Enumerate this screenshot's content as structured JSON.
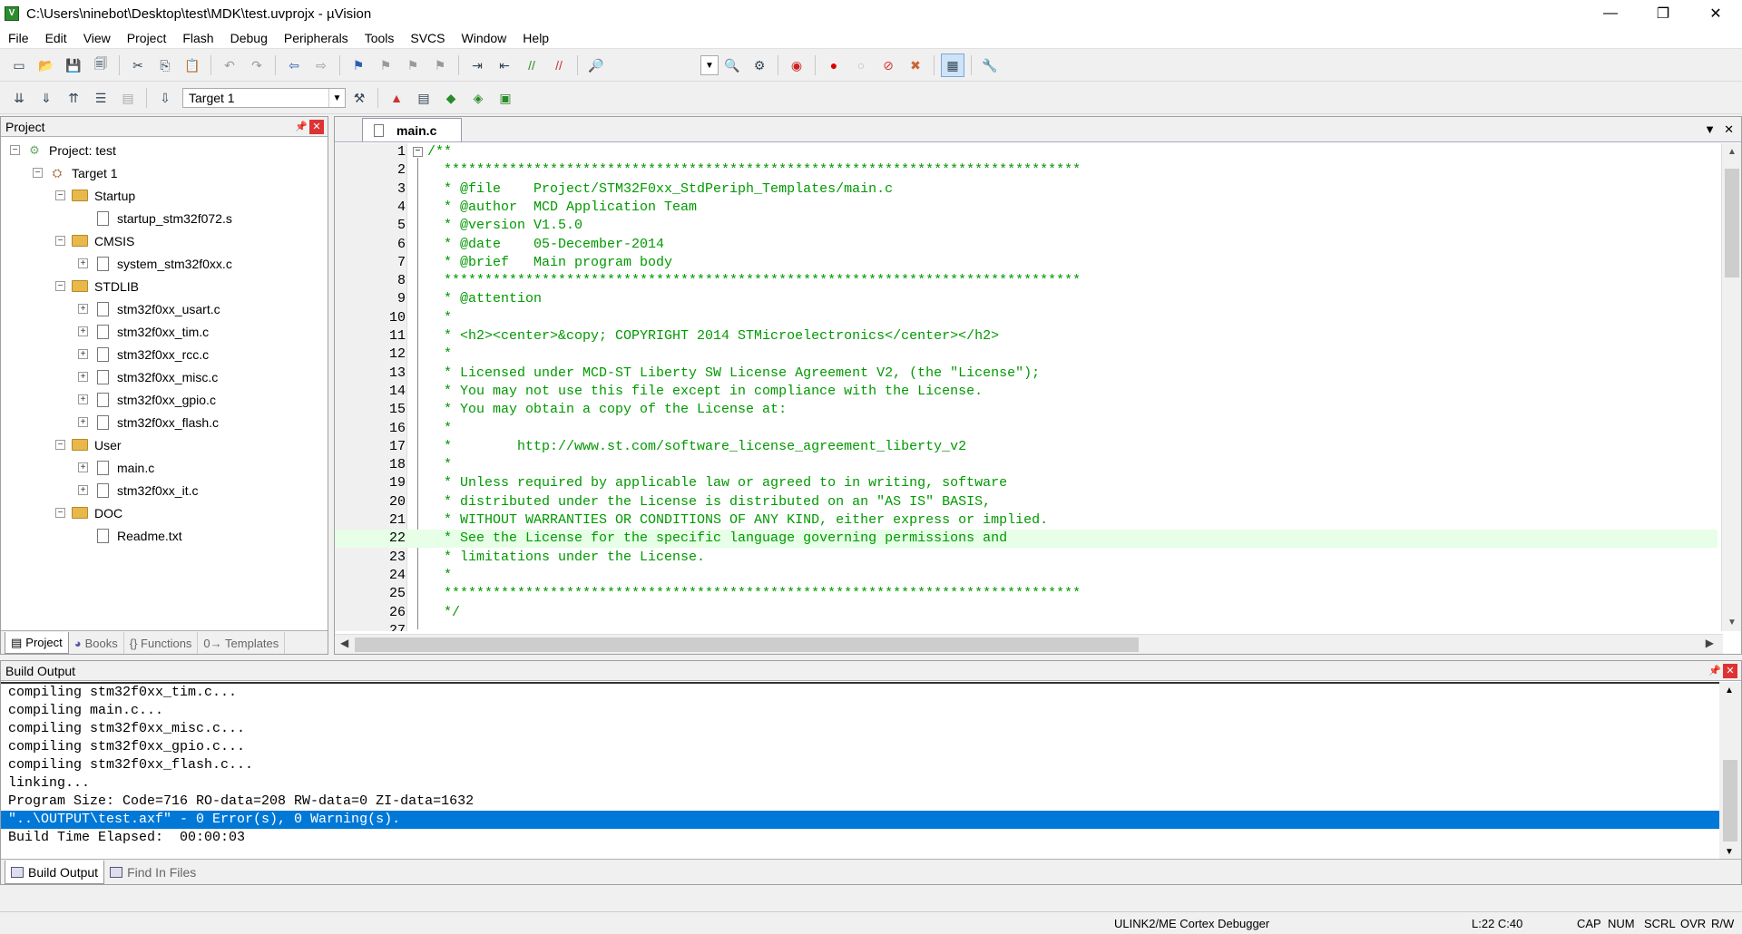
{
  "window": {
    "title": "C:\\Users\\ninebot\\Desktop\\test\\MDK\\test.uvprojx - µVision",
    "minimize": "—",
    "restore": "❐",
    "close": "✕"
  },
  "menu": [
    "File",
    "Edit",
    "View",
    "Project",
    "Flash",
    "Debug",
    "Peripherals",
    "Tools",
    "SVCS",
    "Window",
    "Help"
  ],
  "toolbar2": {
    "target": "Target 1"
  },
  "project_panel": {
    "title": "Project",
    "tree": [
      {
        "label": "Project: test",
        "level": 0,
        "exp": "−",
        "icon": "project"
      },
      {
        "label": "Target 1",
        "level": 1,
        "exp": "−",
        "icon": "target"
      },
      {
        "label": "Startup",
        "level": 2,
        "exp": "−",
        "icon": "folder"
      },
      {
        "label": "startup_stm32f072.s",
        "level": 3,
        "exp": "",
        "icon": "file"
      },
      {
        "label": "CMSIS",
        "level": 2,
        "exp": "−",
        "icon": "folder"
      },
      {
        "label": "system_stm32f0xx.c",
        "level": 3,
        "exp": "+",
        "icon": "file"
      },
      {
        "label": "STDLIB",
        "level": 2,
        "exp": "−",
        "icon": "folder"
      },
      {
        "label": "stm32f0xx_usart.c",
        "level": 3,
        "exp": "+",
        "icon": "file"
      },
      {
        "label": "stm32f0xx_tim.c",
        "level": 3,
        "exp": "+",
        "icon": "file"
      },
      {
        "label": "stm32f0xx_rcc.c",
        "level": 3,
        "exp": "+",
        "icon": "file"
      },
      {
        "label": "stm32f0xx_misc.c",
        "level": 3,
        "exp": "+",
        "icon": "file"
      },
      {
        "label": "stm32f0xx_gpio.c",
        "level": 3,
        "exp": "+",
        "icon": "file"
      },
      {
        "label": "stm32f0xx_flash.c",
        "level": 3,
        "exp": "+",
        "icon": "file"
      },
      {
        "label": "User",
        "level": 2,
        "exp": "−",
        "icon": "folder"
      },
      {
        "label": "main.c",
        "level": 3,
        "exp": "+",
        "icon": "file"
      },
      {
        "label": "stm32f0xx_it.c",
        "level": 3,
        "exp": "+",
        "icon": "file"
      },
      {
        "label": "DOC",
        "level": 2,
        "exp": "−",
        "icon": "folder"
      },
      {
        "label": "Readme.txt",
        "level": 3,
        "exp": "",
        "icon": "file"
      }
    ],
    "tabs": [
      "Project",
      "Books",
      "{} Functions",
      "0→ Templates"
    ]
  },
  "editor": {
    "tab": "main.c",
    "cursor_line": 22,
    "lines": [
      "/**",
      "  ******************************************************************************",
      "  * @file    Project/STM32F0xx_StdPeriph_Templates/main.c",
      "  * @author  MCD Application Team",
      "  * @version V1.5.0",
      "  * @date    05-December-2014",
      "  * @brief   Main program body",
      "  ******************************************************************************",
      "  * @attention",
      "  *",
      "  * <h2><center>&copy; COPYRIGHT 2014 STMicroelectronics</center></h2>",
      "  *",
      "  * Licensed under MCD-ST Liberty SW License Agreement V2, (the \"License\");",
      "  * You may not use this file except in compliance with the License.",
      "  * You may obtain a copy of the License at:",
      "  *",
      "  *        http://www.st.com/software_license_agreement_liberty_v2",
      "  *",
      "  * Unless required by applicable law or agreed to in writing, software",
      "  * distributed under the License is distributed on an \"AS IS\" BASIS,",
      "  * WITHOUT WARRANTIES OR CONDITIONS OF ANY KIND, either express or implied.",
      "  * See the License for the specific language governing permissions and",
      "  * limitations under the License.",
      "  *",
      "  ******************************************************************************",
      "  */",
      ""
    ]
  },
  "build_output": {
    "title": "Build Output",
    "lines": [
      "compiling stm32f0xx_tim.c...",
      "compiling main.c...",
      "compiling stm32f0xx_misc.c...",
      "compiling stm32f0xx_gpio.c...",
      "compiling stm32f0xx_flash.c...",
      "linking...",
      "Program Size: Code=716 RO-data=208 RW-data=0 ZI-data=1632",
      "\"..\\OUTPUT\\test.axf\" - 0 Error(s), 0 Warning(s).",
      "Build Time Elapsed:  00:00:03"
    ],
    "selected_index": 7,
    "tabs": [
      "Build Output",
      "Find In Files"
    ]
  },
  "status": {
    "debugger": "ULINK2/ME Cortex Debugger",
    "position": "L:22 C:40",
    "cap": "CAP",
    "num": "NUM",
    "scrl": "SCRL",
    "ovr": "OVR",
    "rw": "R/W"
  }
}
